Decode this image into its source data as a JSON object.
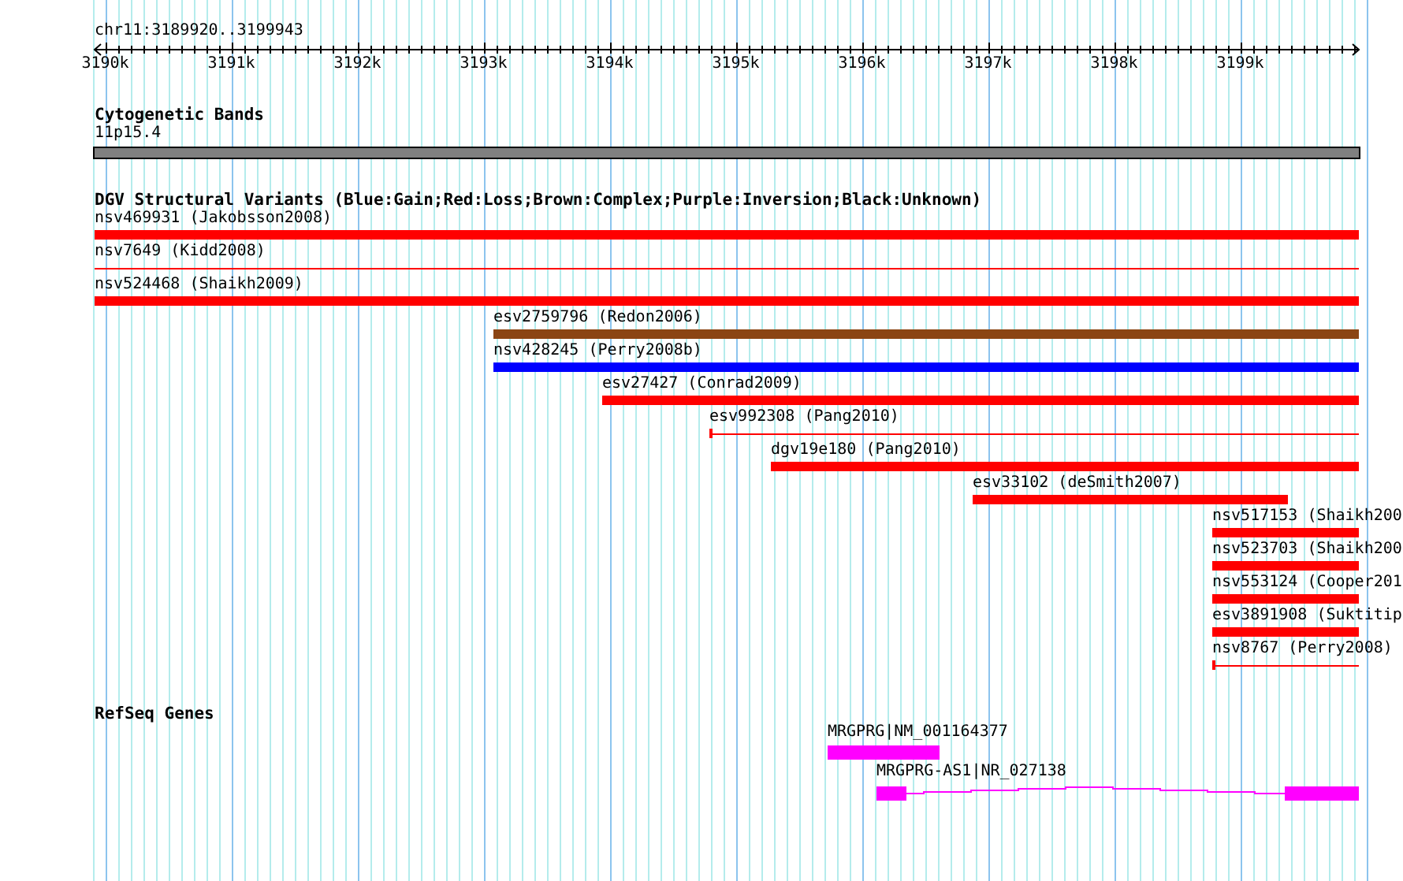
{
  "ruler": {
    "position": "chr11:3189920..3199943",
    "ticks": [
      "3190k",
      "3191k",
      "3192k",
      "3193k",
      "3194k",
      "3195k",
      "3196k",
      "3197k",
      "3198k",
      "3199k"
    ]
  },
  "cytogenetic_bands": {
    "title": "Cytogenetic Bands",
    "band": "11p15.4"
  },
  "dgv_variants": {
    "title": "DGV Structural Variants (Blue:Gain;Red:Loss;Brown:Complex;Purple:Inversion;Black:Unknown)",
    "features": [
      {
        "label": "nsv469931 (Jakobsson2008)",
        "kind": "bar",
        "color": "#ff0000"
      },
      {
        "label": "nsv7649 (Kidd2008)",
        "kind": "line",
        "color": "#ff0000"
      },
      {
        "label": "nsv524468 (Shaikh2009)",
        "kind": "bar",
        "color": "#ff0000"
      },
      {
        "label": "esv2759796 (Redon2006)",
        "kind": "bar",
        "color": "#8b4513"
      },
      {
        "label": "nsv428245 (Perry2008b)",
        "kind": "bar",
        "color": "#0000ff"
      },
      {
        "label": "esv27427 (Conrad2009)",
        "kind": "bar",
        "color": "#ff0000"
      },
      {
        "label": "esv992308 (Pang2010)",
        "kind": "line",
        "color": "#ff0000"
      },
      {
        "label": "dgv19e180 (Pang2010)",
        "kind": "bar",
        "color": "#ff0000"
      },
      {
        "label": "esv33102 (deSmith2007)",
        "kind": "bar",
        "color": "#ff0000"
      },
      {
        "label": "nsv517153 (Shaikh200",
        "kind": "bar",
        "color": "#ff0000"
      },
      {
        "label": "nsv523703 (Shaikh200",
        "kind": "bar",
        "color": "#ff0000"
      },
      {
        "label": "nsv553124 (Cooper201",
        "kind": "bar",
        "color": "#ff0000"
      },
      {
        "label": "esv3891908 (Suktitip",
        "kind": "bar",
        "color": "#ff0000"
      },
      {
        "label": "nsv8767 (Perry2008)",
        "kind": "line",
        "color": "#ff0000"
      }
    ]
  },
  "refseq_genes": {
    "title": "RefSeq Genes",
    "features": [
      {
        "label": "MRGPRG|NM_001164377",
        "kind": "exon"
      },
      {
        "label": "MRGPRG-AS1|NR_027138",
        "kind": "transcript"
      }
    ]
  }
}
